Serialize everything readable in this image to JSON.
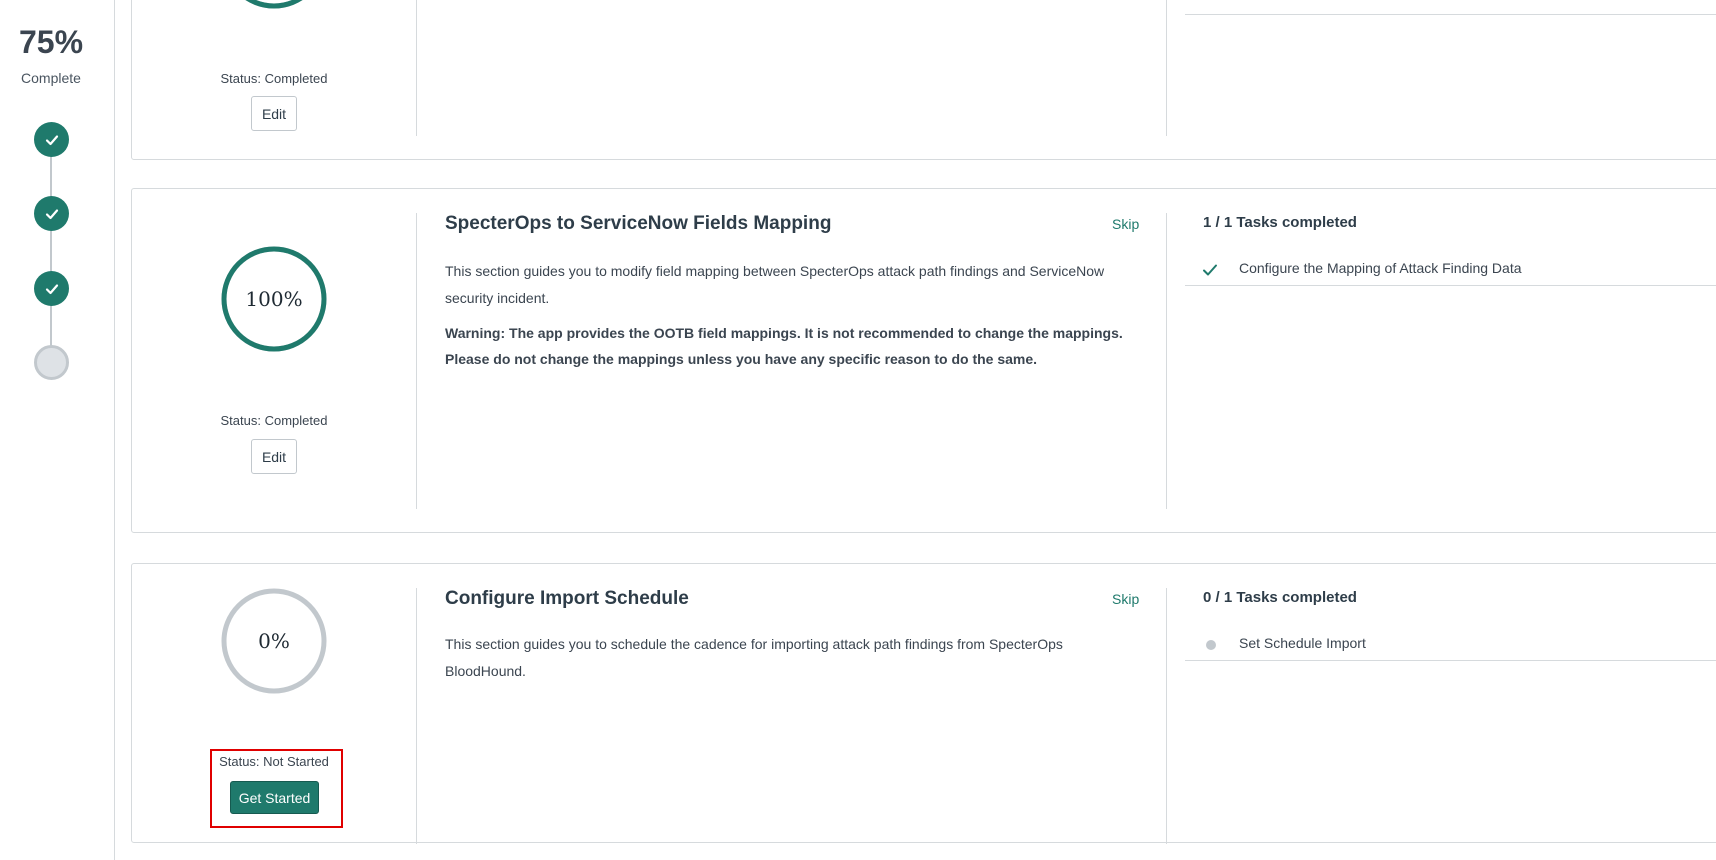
{
  "progress": {
    "percent_text": "75%",
    "label": "Complete",
    "steps": [
      "completed",
      "completed",
      "completed",
      "not-started"
    ]
  },
  "colors": {
    "accent": "#1f7a6c",
    "track": "#c2c8cd",
    "highlight": "#e00000"
  },
  "sections": [
    {
      "percent": 100,
      "status": "Status: Completed",
      "action_label": "Edit"
    },
    {
      "title": "SpecterOps to ServiceNow Fields Mapping",
      "skip_label": "Skip",
      "percent": 100,
      "percent_text": "100%",
      "description": "This section guides you to modify field mapping between SpecterOps attack path findings and ServiceNow security incident.",
      "warning": "Warning: The app provides the OOTB field mappings. It is not recommended to change the mappings. Please do not change the mappings unless you have any specific reason to do the same.",
      "status": "Status: Completed",
      "action_label": "Edit",
      "tasks_summary": "1 / 1 Tasks completed",
      "tasks": [
        {
          "label": "Configure the Mapping of Attack Finding Data",
          "done": true
        }
      ]
    },
    {
      "title": "Configure Import Schedule",
      "skip_label": "Skip",
      "percent": 0,
      "percent_text": "0%",
      "description": "This section guides you to schedule the cadence for importing attack path findings from SpecterOps BloodHound.",
      "status": "Status: Not Started",
      "action_label": "Get Started",
      "tasks_summary": "0 / 1 Tasks completed",
      "tasks": [
        {
          "label": "Set Schedule Import",
          "done": false
        }
      ]
    }
  ]
}
